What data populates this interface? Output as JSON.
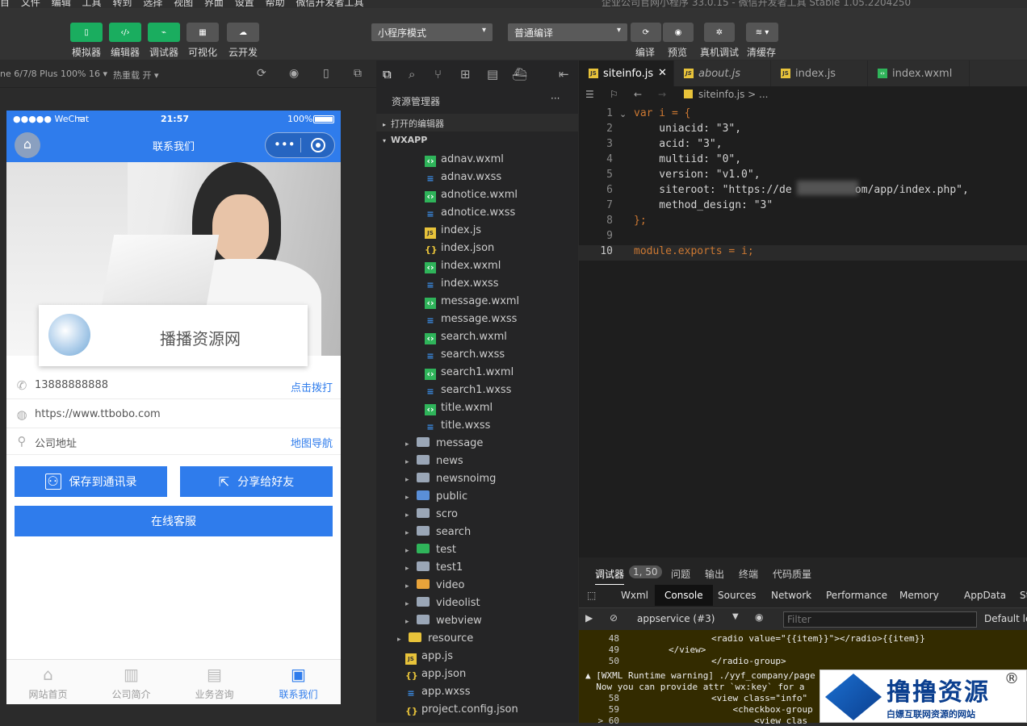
{
  "menubar": {
    "items": [
      "目",
      "文件",
      "编辑",
      "工具",
      "转到",
      "选择",
      "视图",
      "界面",
      "设置",
      "帮助",
      "微信开发者工具"
    ],
    "title": "企业公司官网小程序 33.0.15 - 微信开发者工具 Stable 1.05.2204250"
  },
  "toolbar": {
    "simulator": "模拟器",
    "editor": "编辑器",
    "debugger": "调试器",
    "visual": "可视化",
    "cloud": "云开发",
    "mode_select": "小程序模式",
    "compile_select": "普通编译",
    "compile": "编译",
    "preview": "预览",
    "remote_debug": "真机调试",
    "clear_cache": "清缓存"
  },
  "simbar": {
    "device": "ne 6/7/8 Plus 100% 16 ▾",
    "hot_reload": "热重载 开 ▾"
  },
  "phone": {
    "status": {
      "carrier": "●●●●● WeChat",
      "wifi": "ᯤ",
      "time": "21:57",
      "battery": "100%"
    },
    "nav_title": "联系我们",
    "company": "播播资源网",
    "phone_number": "13888888888",
    "call": "点击拨打",
    "website": "https://www.ttbobo.com",
    "address": "公司地址",
    "map_nav": "地图导航",
    "save_contact": "保存到通讯录",
    "share": "分享给好友",
    "online_service": "在线客服",
    "tabs": [
      {
        "label": "网站首页"
      },
      {
        "label": "公司简介"
      },
      {
        "label": "业务咨询"
      },
      {
        "label": "联系我们"
      }
    ]
  },
  "explorer": {
    "title": "资源管理器",
    "more": "···",
    "open_editors": "打开的编辑器",
    "wxapp": "WXAPP",
    "files": [
      {
        "name": "adnav.wxml",
        "type": "wxml"
      },
      {
        "name": "adnav.wxss",
        "type": "wxss"
      },
      {
        "name": "adnotice.wxml",
        "type": "wxml"
      },
      {
        "name": "adnotice.wxss",
        "type": "wxss"
      },
      {
        "name": "index.js",
        "type": "js"
      },
      {
        "name": "index.json",
        "type": "json"
      },
      {
        "name": "index.wxml",
        "type": "wxml"
      },
      {
        "name": "index.wxss",
        "type": "wxss"
      },
      {
        "name": "message.wxml",
        "type": "wxml"
      },
      {
        "name": "message.wxss",
        "type": "wxss"
      },
      {
        "name": "search.wxml",
        "type": "wxml"
      },
      {
        "name": "search.wxss",
        "type": "wxss"
      },
      {
        "name": "search1.wxml",
        "type": "wxml"
      },
      {
        "name": "search1.wxss",
        "type": "wxss"
      },
      {
        "name": "title.wxml",
        "type": "wxml"
      },
      {
        "name": "title.wxss",
        "type": "wxss"
      }
    ],
    "folders": [
      "message",
      "news",
      "newsnoimg",
      "public",
      "scro",
      "search",
      "test",
      "test1",
      "video",
      "videolist",
      "webview"
    ],
    "resource": "resource",
    "root_files": [
      {
        "name": "app.js",
        "type": "js"
      },
      {
        "name": "app.json",
        "type": "json"
      },
      {
        "name": "app.wxss",
        "type": "wxss"
      },
      {
        "name": "project.config.json",
        "type": "json"
      }
    ]
  },
  "editor": {
    "tabs": [
      {
        "label": "siteinfo.js",
        "close": "✕"
      },
      {
        "label": "about.js"
      },
      {
        "label": "index.js"
      },
      {
        "label": "index.wxml"
      }
    ],
    "breadcrumb": "siteinfo.js > ...",
    "lines": [
      {
        "n": "1",
        "code": "var i = {"
      },
      {
        "n": "2",
        "code": "    uniacid: \"3\","
      },
      {
        "n": "3",
        "code": "    acid: \"3\","
      },
      {
        "n": "4",
        "code": "    multiid: \"0\","
      },
      {
        "n": "5",
        "code": "    version: \"v1.0\","
      },
      {
        "n": "6",
        "code": "    siteroot: \"https://de          om/app/index.php\","
      },
      {
        "n": "7",
        "code": "    method_design: \"3\""
      },
      {
        "n": "8",
        "code": "};"
      },
      {
        "n": "9",
        "code": ""
      },
      {
        "n": "10",
        "code": "module.exports = i;"
      }
    ]
  },
  "debug": {
    "tabs": [
      "调试器",
      "1, 50",
      "问题",
      "输出",
      "终端",
      "代码质量"
    ],
    "panel_tabs": [
      "Wxml",
      "Console",
      "Sources",
      "Network",
      "Performance",
      "Memory",
      "AppData",
      "Stor"
    ],
    "context": "appservice (#3)",
    "filter_placeholder": "Filter",
    "levels": "Default lev",
    "lines": [
      {
        "n": "48",
        "text": "                <radio value=\"{{item}}\"></radio>{{item}}"
      },
      {
        "n": "49",
        "text": "        </view>"
      },
      {
        "n": "50",
        "text": "                </radio-group>"
      },
      {
        "n": "",
        "text": "▲ [WXML Runtime warning] ./yyf_company/page"
      },
      {
        "n": "",
        "text": "  Now you can provide attr `wx:key` for a"
      },
      {
        "n": "58",
        "text": "                <view class=\"info\""
      },
      {
        "n": "59",
        "text": "                    <checkbox-group"
      },
      {
        "n": "> 60",
        "text": "                        <view clas"
      }
    ]
  },
  "watermark": {
    "main": "撸撸资源",
    "sub": "白嫖互联网资源的网站",
    "reg": "®"
  }
}
